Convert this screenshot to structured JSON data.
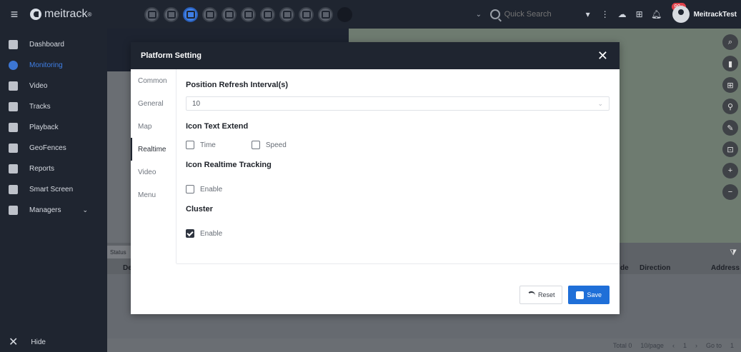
{
  "topbar": {
    "brand": "meitrack",
    "brand_reg": "®",
    "search_placeholder": "Quick Search",
    "notification_count": "99+",
    "username": "MeitrackTest"
  },
  "sidebar": {
    "items": [
      {
        "label": "Dashboard",
        "icon": "dashboard-icon"
      },
      {
        "label": "Monitoring",
        "icon": "location-pin-icon",
        "active": true
      },
      {
        "label": "Video",
        "icon": "video-icon"
      },
      {
        "label": "Tracks",
        "icon": "tracks-icon"
      },
      {
        "label": "Playback",
        "icon": "playback-icon"
      },
      {
        "label": "GeoFences",
        "icon": "geofence-icon"
      },
      {
        "label": "Reports",
        "icon": "reports-icon"
      },
      {
        "label": "Smart Screen",
        "icon": "smart-screen-icon"
      },
      {
        "label": "Managers",
        "icon": "managers-icon"
      }
    ],
    "hide_label": "Hide"
  },
  "background": {
    "status_tab": "Status",
    "col_de": "De",
    "col_de_right": "de",
    "col_direction": "Direction",
    "col_address": "Address",
    "footer_total": "Total 0",
    "footer_per_page": "10/page",
    "footer_page": "1",
    "footer_goto": "Go to",
    "footer_goto_value": "1"
  },
  "modal": {
    "title": "Platform Setting",
    "close": "✕",
    "tabs": [
      "Common",
      "General",
      "Map",
      "Realtime",
      "Video",
      "Menu"
    ],
    "active_tab": "Realtime",
    "refresh_title": "Position Refresh Interval(s)",
    "refresh_value": "10",
    "icon_text_title": "Icon Text Extend",
    "opt_time": "Time",
    "opt_speed": "Speed",
    "tracking_title": "Icon Realtime Tracking",
    "tracking_enable": "Enable",
    "cluster_title": "Cluster",
    "cluster_enable": "Enable",
    "reset_label": "Reset",
    "save_label": "Save"
  },
  "colors": {
    "topbar": "#1f2530",
    "accent": "#1f6fd8",
    "active_nav": "#3f7fe6"
  }
}
